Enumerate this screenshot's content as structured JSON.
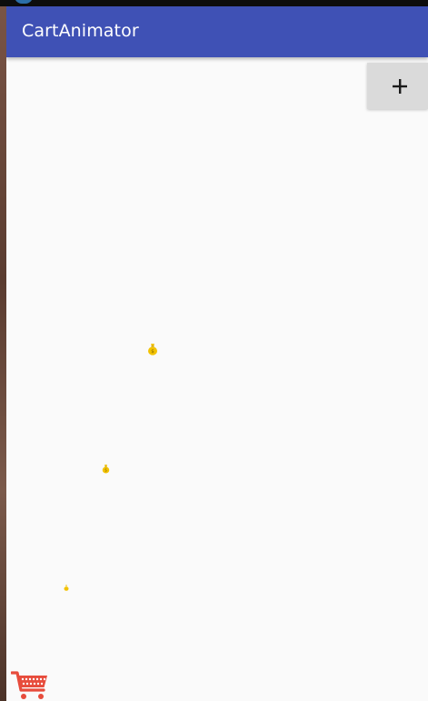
{
  "app": {
    "title": "CartAnimator"
  },
  "toolbar": {
    "add_button_icon": "plus-icon"
  },
  "items": [
    {
      "icon": "money-bag-icon",
      "color": "#f2c200"
    },
    {
      "icon": "money-bag-icon",
      "color": "#f2c200"
    },
    {
      "icon": "money-bag-icon",
      "color": "#f2c200"
    }
  ],
  "cart": {
    "icon": "shopping-cart-icon",
    "color": "#e74c3c"
  },
  "theme": {
    "primary": "#3f51b5",
    "background": "#fafafa",
    "button": "#dadada"
  }
}
